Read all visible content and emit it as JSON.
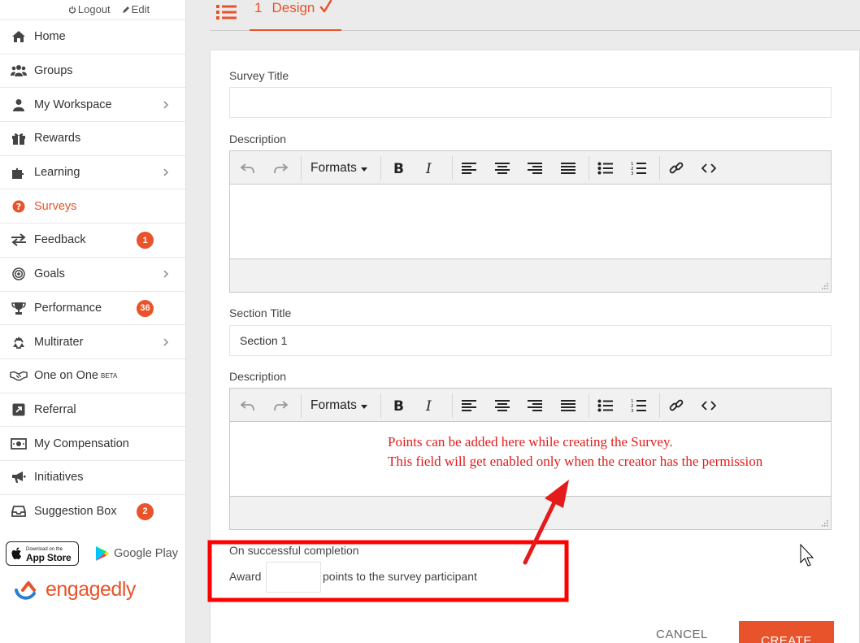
{
  "account": {
    "logout": "Logout",
    "edit": "Edit"
  },
  "nav": [
    {
      "label": "Home",
      "icon": "home-icon"
    },
    {
      "label": "Groups",
      "icon": "groups-icon"
    },
    {
      "label": "My Workspace",
      "icon": "user-icon",
      "chevron": true
    },
    {
      "label": "Rewards",
      "icon": "gift-icon"
    },
    {
      "label": "Learning",
      "icon": "puzzle-icon",
      "chevron": true
    },
    {
      "label": "Surveys",
      "icon": "question-icon",
      "active": true
    },
    {
      "label": "Feedback",
      "icon": "exchange-icon",
      "badge": "1"
    },
    {
      "label": "Goals",
      "icon": "target-icon",
      "chevron": true
    },
    {
      "label": "Performance",
      "icon": "trophy-icon",
      "badge": "36"
    },
    {
      "label": "Multirater",
      "icon": "recycle-icon",
      "chevron": true
    },
    {
      "label": "One on One",
      "icon": "handshake-icon",
      "sup": "BETA"
    },
    {
      "label": "Referral",
      "icon": "share-icon"
    },
    {
      "label": "My Compensation",
      "icon": "money-icon"
    },
    {
      "label": "Initiatives",
      "icon": "bullhorn-icon"
    },
    {
      "label": "Suggestion Box",
      "icon": "inbox-icon",
      "badge": "2"
    }
  ],
  "stores": {
    "app_store_small": "Download on the",
    "app_store_big": "App Store",
    "google_play": "Google Play"
  },
  "brand": {
    "name": "engagedly"
  },
  "tabs": {
    "design_number": "1",
    "design_label": "Design"
  },
  "form": {
    "survey_title_label": "Survey Title",
    "survey_title_value": "",
    "description_label": "Description",
    "section_title_label": "Section Title",
    "section_title_value": "Section 1",
    "description2_label": "Description",
    "formats_label": "Formats",
    "completion_label": "On successful completion",
    "award_prefix": "Award",
    "points_value": "",
    "award_suffix": "points to the survey participant"
  },
  "annotation": {
    "line1": "Points can be added here while creating the Survey.",
    "line2": "This field will get enabled only when the creator has the permission"
  },
  "actions": {
    "cancel": "CANCEL",
    "create": "CREATE"
  },
  "colors": {
    "accent": "#e8532b",
    "annotation": "#e31b1b"
  }
}
